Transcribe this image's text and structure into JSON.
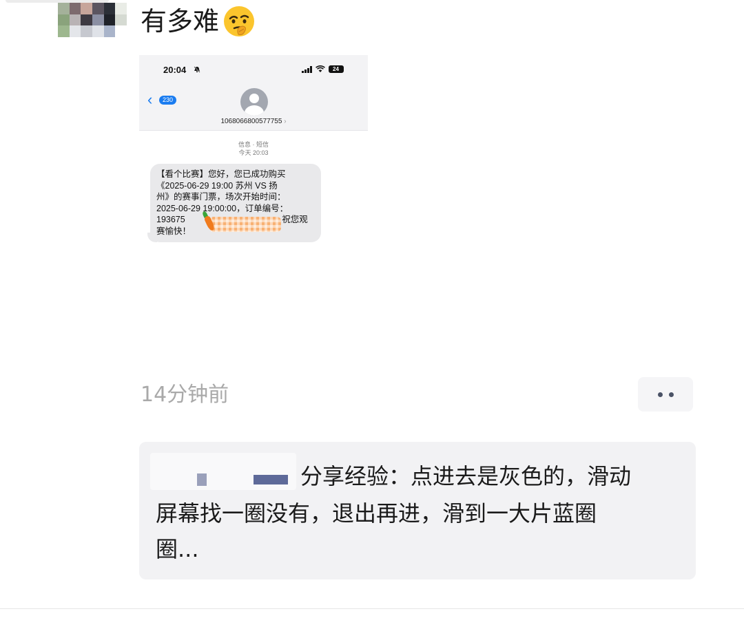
{
  "post": {
    "text": "有多难",
    "emoji": "thinking-face-emoji"
  },
  "screenshot": {
    "status_time": "20:04",
    "battery": "24",
    "back_badge": "230",
    "contact_number": "1068066800577755",
    "message_meta_line1": "信息 · 短信",
    "message_meta_line2": "今天 20:03",
    "sms_lines": [
      "【看个比赛】您好，您已成功购买",
      "《2025-06-29 19:00 苏州 VS 扬",
      "州》的赛事门票，场次开始时间：",
      "2025-06-29 19:00:00，订单编号：",
      "193675",
      "赛愉快！"
    ],
    "sms_line5_tail": "，祝您观"
  },
  "time_ago": "14分钟前",
  "comment": {
    "line1": "分享经验：点进去是灰色的，滑动",
    "line2": "屏幕找一圈没有，退出再进，滑到一大片蓝圈",
    "line3": "圈..."
  },
  "colors": {
    "accent_blue": "#1a7cf0",
    "time_gray": "#a9a9a9",
    "comment_bg": "#f2f2f4"
  }
}
